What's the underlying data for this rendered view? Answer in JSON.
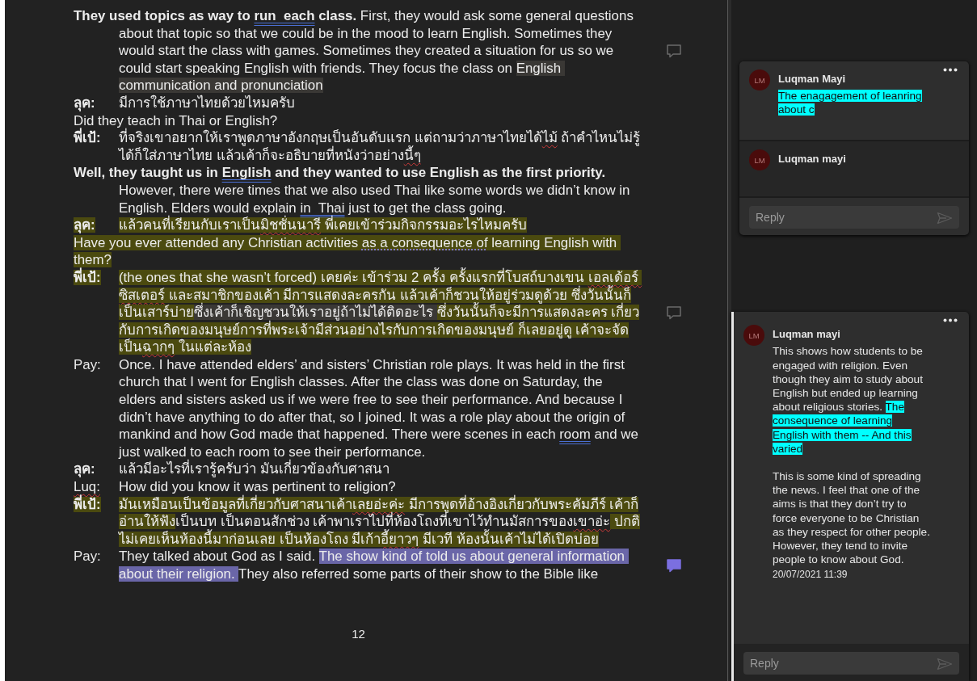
{
  "document": {
    "paragraphs": [
      {
        "kind": "hanging",
        "segments": [
          {
            "text": "They used topics as way to ",
            "bold": true,
            "kind": "plain"
          },
          {
            "text": "run  each",
            "bold": true,
            "kind": "grammar"
          },
          {
            "text": " class.",
            "bold": true,
            "kind": "plain"
          },
          {
            "text": " First, they would ask some general questions about that topic so that we could be in the mood to learn English. Sometimes they would start the class with games. Sometimes they created a situation for us so we could start speaking English with friends. They focus the class on ",
            "bold": false,
            "kind": "plain"
          },
          {
            "text": "English communication and pronunciation",
            "bold": false,
            "kind": "plain",
            "color": "#3a3835"
          }
        ],
        "comment": {
          "selected": false
        }
      },
      {
        "kind": "speaker",
        "speaker": {
          "text": "ลุค:",
          "bold": true,
          "kind": "plain"
        },
        "segments": [
          {
            "text": "มีการใช้ภาษาไทยด้วยไหมครับ",
            "bold": false,
            "kind": "plain"
          }
        ]
      },
      {
        "kind": "plain",
        "segments": [
          {
            "text": "Did they teach in Thai or English?",
            "bold": false,
            "kind": "plain"
          }
        ]
      },
      {
        "kind": "speaker",
        "speaker": {
          "text": "พี่เป้:",
          "bold": true,
          "kind": "plain"
        },
        "segments": [
          {
            "text": "ที่จริงเขาอยากให้เราพูดภาษาอังกฤษเป็นอันดับแรก แต่ถามว่าภาษาไทยได้",
            "bold": false,
            "kind": "plain"
          },
          {
            "text": "ไม้",
            "bold": false,
            "kind": "spelling"
          },
          {
            "text": " ถ้าคำไหนไม่รู้ ได้ก็ใส่ภาษาไทย แล้วเค้าก็จะอธิบายที่หนังว่าอย่าง",
            "bold": false,
            "kind": "plain"
          },
          {
            "text": "นี้ๆ",
            "bold": false,
            "kind": "spelling"
          }
        ]
      },
      {
        "kind": "hanging",
        "segments": [
          {
            "text": "Well, they taught us in ",
            "bold": true,
            "kind": "plain"
          },
          {
            "text": "English",
            "bold": true,
            "kind": "grammar"
          },
          {
            "text": " and they wanted to use English as the first priority.",
            "bold": true,
            "kind": "plain"
          },
          {
            "text": " However, there were times that we also used Thai like some words we didn’t know in English. Elders would explain ",
            "bold": false,
            "kind": "plain"
          },
          {
            "text": "in  Thai",
            "bold": false,
            "kind": "grammar"
          },
          {
            "text": " just to get the class going.",
            "bold": false,
            "kind": "plain"
          }
        ]
      },
      {
        "kind": "speaker",
        "speaker": {
          "text": "ลุค:",
          "bold": true,
          "kind": "plain",
          "color": "#4b4a0f"
        },
        "segments": [
          {
            "text": "แล้วคนที่เรียนกับเราเป็น",
            "bold": false,
            "kind": "plain",
            "color": "#4b4a0f"
          },
          {
            "text": "มิชชั่นนารี",
            "bold": false,
            "kind": "spelling",
            "color": "#4b4a0f"
          },
          {
            "text": " พี่เคยเข้าร่วมกิจกรรมอะไรไหมครับ",
            "bold": false,
            "kind": "plain",
            "color": "#4b4a0f"
          }
        ]
      },
      {
        "kind": "plain",
        "segments": [
          {
            "text": "Have you ever attended any Christian activities ",
            "bold": false,
            "kind": "plain",
            "color": "#4b4a0f"
          },
          {
            "text": "as a consequence of",
            "bold": false,
            "kind": "style",
            "color": "#4b4a0f"
          },
          {
            "text": " learning English with them?",
            "bold": false,
            "kind": "plain",
            "color": "#4b4a0f"
          }
        ]
      },
      {
        "kind": "speaker",
        "speaker": {
          "text": "พี่เป้:",
          "bold": true,
          "kind": "plain",
          "color": "#4b4a0f"
        },
        "segments": [
          {
            "text": "(the ones that she wasn’t forced) เคยค่ะ เข้าร่วม 2 ครั้ง ครั้งแรกที่โบสถ์บางเขน ",
            "bold": false,
            "kind": "plain",
            "color": "#4b4a0f"
          },
          {
            "text": "เอลเด้อร์ ซิสเตอร์",
            "bold": false,
            "kind": "spelling",
            "color": "#4b4a0f"
          },
          {
            "text": " และสมาชิกของเค้า มีการแสดงละครกัน แล้วเค้าก็ชวนให้อยู่ร่วมดูด้วย ซึ่งวันนั้นก็เป็นเสาร์บ่าย",
            "bold": false,
            "kind": "plain",
            "color": "#4b4a0f"
          },
          {
            "text": "ซึ่งเค้าก็เชิญชวนให้เราอยู่ถ้าไม่ได้ติดอะไร ",
            "bold": false,
            "kind": "plain",
            "color": "#3a3835"
          },
          {
            "text": "ซึ่งวันนั้นก็จะมีการแสดงละคร เกี่ยวกับการเกิดของมนุษย์การที่พระเจ้ามีส่วนอย่างไรกับการเกิดของมนุษย์ ก็เลยอยู่ดู เค้าจะจัดเป็น",
            "bold": false,
            "kind": "plain",
            "color": "#4b4a0f"
          },
          {
            "text": "ฉากๆ",
            "bold": false,
            "kind": "spelling",
            "color": "#4b4a0f"
          },
          {
            "text": " ในแต่ละห้อง",
            "bold": false,
            "kind": "plain",
            "color": "#4b4a0f"
          }
        ],
        "comment": {
          "selected": false
        }
      },
      {
        "kind": "speaker",
        "speaker": {
          "text": "Pay:",
          "bold": false,
          "kind": "plain"
        },
        "segments": [
          {
            "text": "Once. I have attended elders’ and sisters’ Christian role plays. It was held in the first church that I went for English classes. After the class was done on Saturday, the elders and sisters asked us if we were free to see their performance. And because I didn’t have anything to do after that, so I joined. It was a role play about the origin of mankind and how God made that happened. There were scenes in each ",
            "bold": false,
            "kind": "plain"
          },
          {
            "text": "room",
            "bold": false,
            "kind": "grammar"
          },
          {
            "text": " and we just walked to each room to see their performance.",
            "bold": false,
            "kind": "plain"
          }
        ]
      },
      {
        "kind": "speaker",
        "speaker": {
          "text": "ลุค:",
          "bold": true,
          "kind": "plain"
        },
        "segments": [
          {
            "text": "แล้วมีอะไรที่เรารู้ครับว่า มันเกี่ยวข้องกับศาสนา",
            "bold": false,
            "kind": "plain"
          }
        ]
      },
      {
        "kind": "speaker",
        "speaker": {
          "text": "Luq:",
          "bold": false,
          "kind": "spelling"
        },
        "segments": [
          {
            "text": "How did you know it was pertinent to religion?",
            "bold": false,
            "kind": "plain"
          }
        ]
      },
      {
        "kind": "speaker",
        "speaker": {
          "text": "พี่เป้:",
          "bold": true,
          "kind": "plain",
          "color": "#4b4a0f"
        },
        "segments": [
          {
            "text": "มันเหมือนเป็นข้อมูลที่เกี่ยวกับศาสนาเค้า",
            "bold": false,
            "kind": "plain",
            "color": "#4b4a0f"
          },
          {
            "text": "เลยอ่ะค่ะ",
            "bold": false,
            "kind": "spelling",
            "color": "#4b4a0f"
          },
          {
            "text": " มีการพูดที่อ้างอิงเกี่ยวกับพระคัมภีร์ เค้าก็อ่านให้ฟัง",
            "bold": false,
            "kind": "plain",
            "color": "#4b4a0f"
          },
          {
            "text": "เป็นบท เป็นตอนสักช่วง เค้าพาเราไปที่ห้องโถงที่เขาไว้ทำนมัสการของ",
            "bold": false,
            "kind": "plain"
          },
          {
            "text": "เขาอ่ะ",
            "bold": false,
            "kind": "spelling"
          },
          {
            "text": " ปกติไม่เคยเห็นห้องนี้มาก่อนเลย เป็นห้องโถง มีเก้า",
            "bold": false,
            "kind": "plain",
            "color": "#4b4a0f"
          },
          {
            "text": "อี้ยาวๆ",
            "bold": false,
            "kind": "spelling",
            "color": "#4b4a0f"
          },
          {
            "text": " มีเวที ห้องนั้นเค้าไม่ได้เปิดบ่อย",
            "bold": false,
            "kind": "plain",
            "color": "#4b4a0f"
          }
        ]
      },
      {
        "kind": "speaker",
        "speaker": {
          "text": "Pay:",
          "bold": false,
          "kind": "plain"
        },
        "segments": [
          {
            "text": "They talked about God as I said. ",
            "bold": false,
            "kind": "plain"
          },
          {
            "text": "The show kind of told us about general information about their religion. ",
            "bold": false,
            "kind": "plain",
            "color": "#6a66a8"
          },
          {
            "text": "They also referred some parts of their show to the Bible like",
            "bold": false,
            "kind": "plain"
          }
        ],
        "comment": {
          "selected": true
        }
      }
    ],
    "page_number": "12"
  },
  "comments": [
    {
      "active": false,
      "threads": [
        {
          "initials": "LM",
          "author": "Luqman Mayi",
          "more": true,
          "body": [
            [
              {
                "text": "The enagagement of leanring about c",
                "highlighted": true
              }
            ]
          ]
        },
        {
          "initials": "LM",
          "author": "Luqman mayi"
        }
      ],
      "reply_placeholder": "Reply"
    },
    {
      "active": true,
      "threads": [
        {
          "initials": "LM",
          "author": "Luqman mayi",
          "more": true,
          "body": [
            [
              {
                "text": "This shows how students to be engaged with religion. Even though they aim to study about English but ended up learning about religious stories. ",
                "highlighted": false
              },
              {
                "text": "The consequence of learning English with them  -- And this varied",
                "highlighted": true
              }
            ],
            [
              {
                "text": "This is some kind of spreading the news. I feel that one of the aims is that they don’t try to force everyone to be Christian as they respect for other people. However, they tend to invite people to know about God.",
                "highlighted": false
              }
            ]
          ],
          "timestamp": "20/07/2021 11:39"
        }
      ],
      "reply_placeholder": "Reply"
    }
  ]
}
